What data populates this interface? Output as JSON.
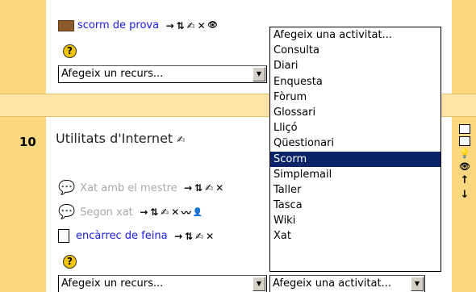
{
  "top_section": {
    "activity": {
      "icon": "package-icon",
      "label": "scorm de prova"
    },
    "add_resource": "Afegeix un recurs..."
  },
  "section10": {
    "number": "10",
    "title": "Utilitats d'Internet",
    "activities": [
      {
        "icon": "chat-icon",
        "label": "Xat amb el mestre",
        "hidden": true
      },
      {
        "icon": "chat-icon",
        "label": "Segon xat",
        "hidden": true
      },
      {
        "icon": "assignment-icon",
        "label": "encàrrec de feina",
        "hidden": false
      }
    ],
    "add_resource": "Afegeix un recurs...",
    "add_activity": "Afegeix una activitat..."
  },
  "dropdown": {
    "options": [
      "Afegeix una activitat...",
      "Consulta",
      "Diari",
      "Enquesta",
      "Fòrum",
      "Glossari",
      "Lliçó",
      "Qüestionari",
      "Scorm",
      "Simplemail",
      "Taller",
      "Tasca",
      "Wiki",
      "Xat"
    ],
    "selected": "Scorm"
  },
  "glyphs": {
    "move_right": "→",
    "move_updown": "⇅",
    "edit": "✍",
    "delete": "✕",
    "show": "👁",
    "hide": "〰",
    "user": "👤",
    "help": "?",
    "up": "↑",
    "down": "↓",
    "bulb": "💡",
    "dropdown_arrow": "▼"
  },
  "colors": {
    "sidebar": "#fbd77f",
    "divider": "#fde4a6",
    "link": "#1a1ae6",
    "link_dim": "#a8a8a8",
    "selected": "#0a246a"
  }
}
